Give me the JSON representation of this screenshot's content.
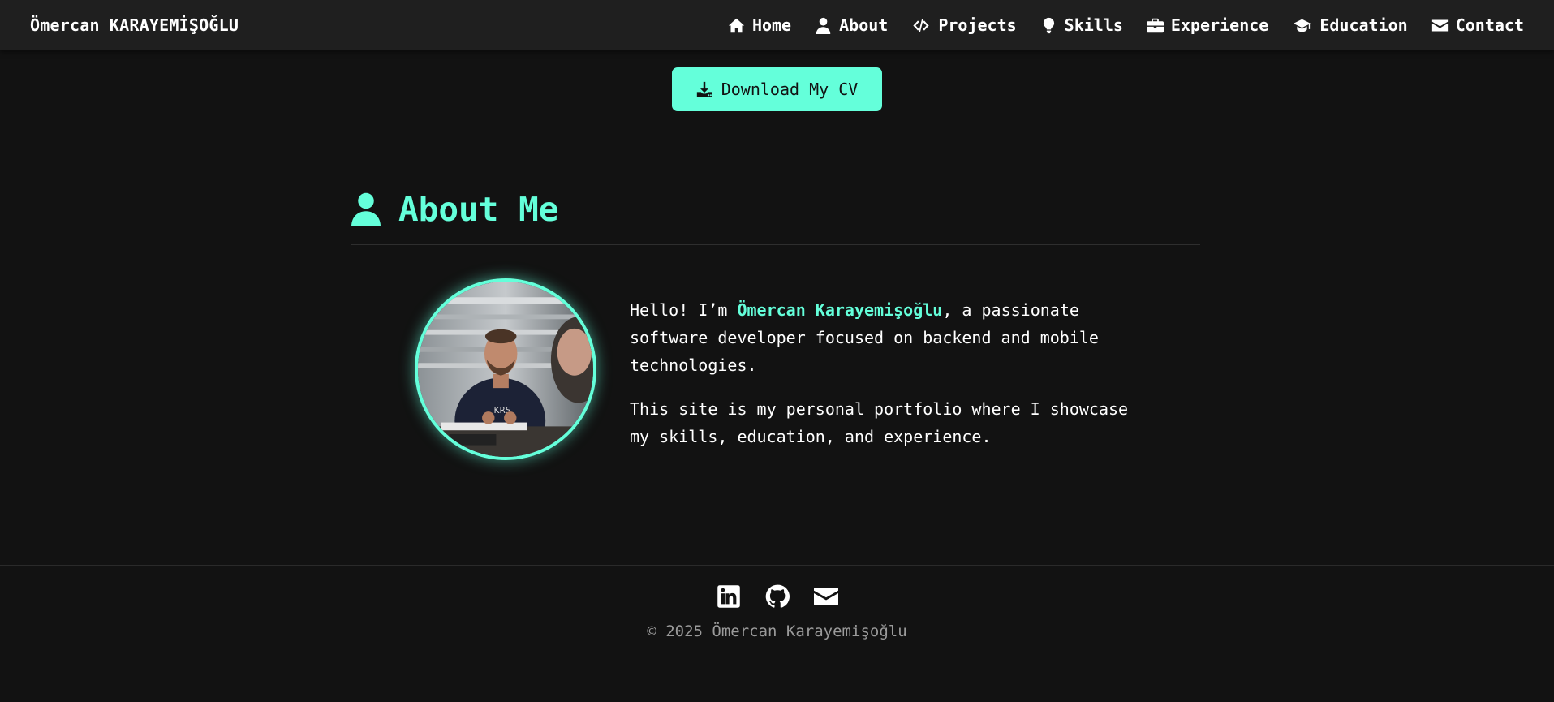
{
  "nav": {
    "brand": "Ömercan KARAYEMİŞOĞLU",
    "links": [
      {
        "label": "Home",
        "icon": "home-icon"
      },
      {
        "label": "About",
        "icon": "user-icon"
      },
      {
        "label": "Projects",
        "icon": "code-icon"
      },
      {
        "label": "Skills",
        "icon": "lightbulb-icon"
      },
      {
        "label": "Experience",
        "icon": "briefcase-icon"
      },
      {
        "label": "Education",
        "icon": "graduation-cap-icon"
      },
      {
        "label": "Contact",
        "icon": "envelope-icon"
      }
    ]
  },
  "cv_button": {
    "label": "Download My CV",
    "icon": "download-icon"
  },
  "about": {
    "title": "About Me",
    "icon": "user-icon",
    "intro_before": "Hello! I’m ",
    "name": "Ömercan Karayemişoğlu",
    "intro_after": ", a passionate software developer focused on backend and mobile technologies.",
    "paragraph2": "This site is my personal portfolio where I showcase my skills, education, and experience."
  },
  "footer": {
    "social": [
      {
        "icon": "linkedin-icon"
      },
      {
        "icon": "github-icon"
      },
      {
        "icon": "envelope-icon"
      }
    ],
    "copyright": "© 2025 Ömercan Karayemişoğlu"
  },
  "colors": {
    "accent": "#64ffda",
    "background": "#121212",
    "navbar": "#1f1f1f"
  }
}
